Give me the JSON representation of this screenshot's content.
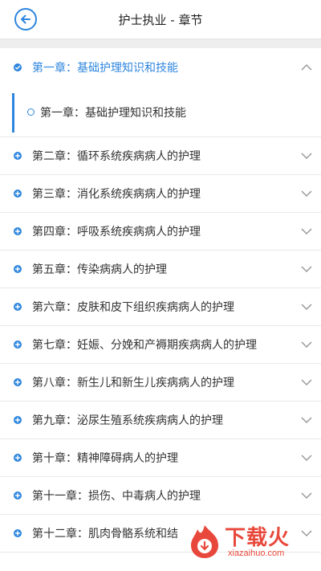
{
  "header": {
    "title": "护士执业 - 章节",
    "back_icon": "back-arrow-icon"
  },
  "colors": {
    "accent": "#2e86de",
    "divider": "#e9e9e9",
    "strip": "#eeeeee",
    "watermark": "#e8483b"
  },
  "chapters": [
    {
      "label": "第一章：基础护理知识和技能",
      "expanded": true
    },
    {
      "label": "第二章：循环系统疾病病人的护理"
    },
    {
      "label": "第三章：消化系统疾病病人的护理"
    },
    {
      "label": "第四章：呼吸系统疾病病人的护理"
    },
    {
      "label": "第五章：传染病病人的护理"
    },
    {
      "label": "第六章：皮肤和皮下组织疾病病人的护理"
    },
    {
      "label": "第七章：妊娠、分娩和产褥期疾病病人的护理"
    },
    {
      "label": "第八章：新生儿和新生儿疾病病人的护理"
    },
    {
      "label": "第九章：泌尿生殖系统疾病病人的护理"
    },
    {
      "label": "第十章：精神障碍病人的护理"
    },
    {
      "label": "第十一章：损伤、中毒病人的护理"
    },
    {
      "label": "第十二章：肌肉骨骼系统和结"
    }
  ],
  "sub_items": [
    {
      "label": "第一章：基础护理知识和技能"
    }
  ],
  "watermark": {
    "text": "下载火",
    "sub": "xiazaihuo.com"
  }
}
